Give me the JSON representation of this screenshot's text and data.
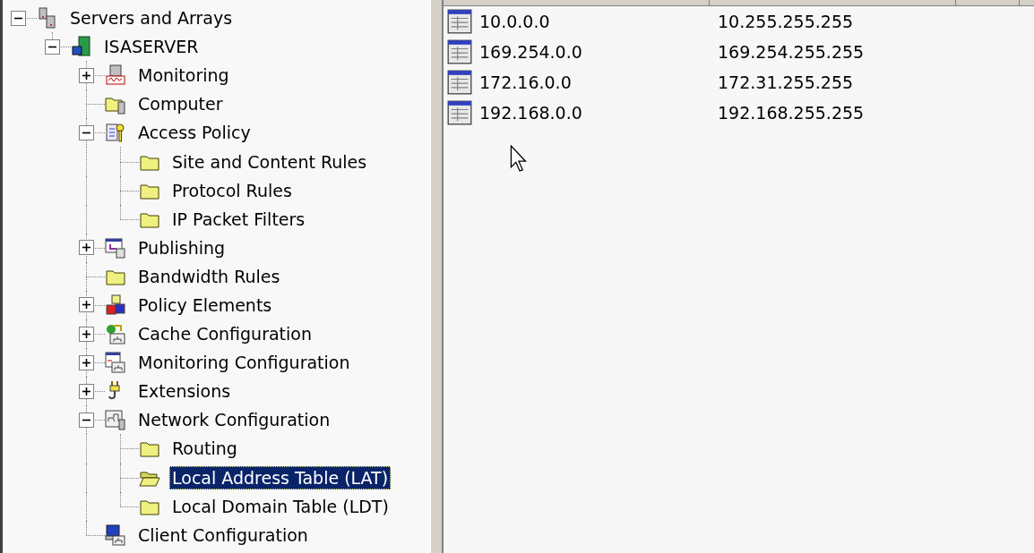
{
  "tree": [
    {
      "label": "Servers and Arrays",
      "kind": "servers",
      "expanded": true,
      "selected": false,
      "children": [
        {
          "label": "ISASERVER",
          "kind": "server",
          "expanded": true,
          "selected": false,
          "children": [
            {
              "label": "Monitoring",
              "kind": "monitoring",
              "expanded": false,
              "selected": false
            },
            {
              "label": "Computer",
              "kind": "computer",
              "selected": false
            },
            {
              "label": "Access Policy",
              "kind": "policy",
              "expanded": true,
              "selected": false,
              "children": [
                {
                  "label": "Site and Content Rules",
                  "kind": "folder",
                  "selected": false
                },
                {
                  "label": "Protocol Rules",
                  "kind": "folder",
                  "selected": false
                },
                {
                  "label": "IP Packet Filters",
                  "kind": "folder",
                  "selected": false
                }
              ]
            },
            {
              "label": "Publishing",
              "kind": "publishing",
              "expanded": false,
              "selected": false
            },
            {
              "label": "Bandwidth Rules",
              "kind": "folder",
              "selected": false
            },
            {
              "label": "Policy Elements",
              "kind": "elements",
              "expanded": false,
              "selected": false
            },
            {
              "label": "Cache Configuration",
              "kind": "cache",
              "expanded": false,
              "selected": false
            },
            {
              "label": "Monitoring Configuration",
              "kind": "monconfig",
              "expanded": false,
              "selected": false
            },
            {
              "label": "Extensions",
              "kind": "plug",
              "expanded": false,
              "selected": false
            },
            {
              "label": "Network Configuration",
              "kind": "network",
              "expanded": true,
              "selected": false,
              "children": [
                {
                  "label": "Routing",
                  "kind": "folder",
                  "selected": false
                },
                {
                  "label": "Local Address Table (LAT)",
                  "kind": "folder",
                  "selected": true
                },
                {
                  "label": "Local Domain Table (LDT)",
                  "kind": "folder",
                  "selected": false
                }
              ]
            },
            {
              "label": "Client Configuration",
              "kind": "client",
              "selected": false
            }
          ]
        }
      ]
    }
  ],
  "list": {
    "rows": [
      {
        "column_1": "10.0.0.0",
        "column_2": "10.255.255.255"
      },
      {
        "column_1": "169.254.0.0",
        "column_2": "169.254.255.255"
      },
      {
        "column_1": "172.16.0.0",
        "column_2": "172.31.255.255"
      },
      {
        "column_1": "192.168.0.0",
        "column_2": "192.168.255.255"
      }
    ]
  }
}
